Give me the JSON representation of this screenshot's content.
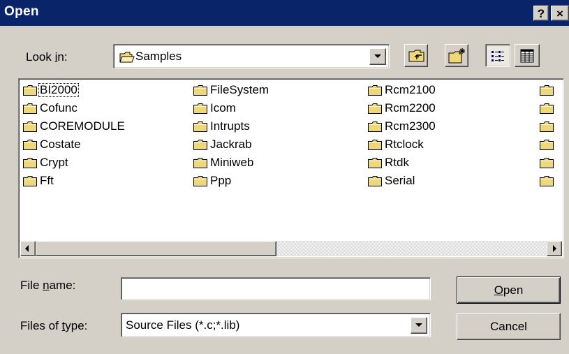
{
  "window": {
    "title": "Open",
    "help_button": "?",
    "close_button": "×"
  },
  "look_in": {
    "label_pre": "Look ",
    "label_accel": "i",
    "label_post": "n:",
    "value": "Samples"
  },
  "toolbar": {
    "up_icon": "up-one-level-icon",
    "new_folder_icon": "new-folder-icon",
    "list_view_icon": "list-view-icon",
    "details_view_icon": "details-view-icon"
  },
  "files": {
    "col1": [
      "BI2000",
      "Cofunc",
      "COREMODULE",
      "Costate",
      "Crypt",
      "Fft"
    ],
    "col2": [
      "FileSystem",
      "Icom",
      "Intrupts",
      "Jackrab",
      "Miniweb",
      "Ppp"
    ],
    "col3": [
      "Rcm2100",
      "Rcm2200",
      "Rcm2300",
      "Rtclock",
      "Rtdk",
      "Serial"
    ],
    "focused": "BI2000"
  },
  "file_name": {
    "label_pre": "File ",
    "label_accel": "n",
    "label_post": "ame:",
    "value": ""
  },
  "files_of_type": {
    "label_pre": "Files of ",
    "label_accel": "t",
    "label_post": "ype:",
    "value": "Source Files (*.c;*.lib)"
  },
  "buttons": {
    "open_accel": "O",
    "open_rest": "pen",
    "cancel": "Cancel"
  },
  "colors": {
    "titlebar": "#0a246a",
    "face": "#d4d0c8",
    "folder": "#f0d878"
  }
}
